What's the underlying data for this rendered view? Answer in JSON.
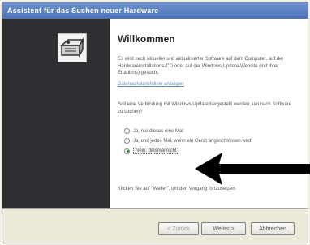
{
  "window": {
    "title": "Assistent für das Suchen neuer Hardware"
  },
  "content": {
    "heading": "Willkommen",
    "intro": "Es wird nach aktueller und aktualisierter Software auf dem Computer, auf der Hardwareinstallations-CD oder auf der Windows Update-Website (mit Ihrer Erlaubnis) gesucht.",
    "privacy_link": "Datenschutzrichtlinie anzeigen",
    "question": "Soll eine Verbindung mit Windows Update hergestellt werden, um nach Software zu suchen?",
    "options": [
      {
        "label": "Ja, nur dieses eine Mal",
        "selected": false
      },
      {
        "label": "Ja, und jedes Mal, wenn ein Gerät angeschlossen wird",
        "selected": false
      },
      {
        "label": "Nein, diesmal nicht",
        "selected": true
      }
    ],
    "continue_text": "Klicken Sie auf \"Weiter\", um den Vorgang fortzusetzen."
  },
  "buttons": {
    "back": "< Zurück",
    "next": "Weiter >",
    "cancel": "Abbrechen"
  },
  "icons": {
    "wizard": "hardware-wizard-icon",
    "pointer": "arrow-pointer-icon"
  },
  "colors": {
    "title_bar": "#5a7fc2",
    "left_panel": "#2e2f33",
    "link": "#5f86b8"
  }
}
